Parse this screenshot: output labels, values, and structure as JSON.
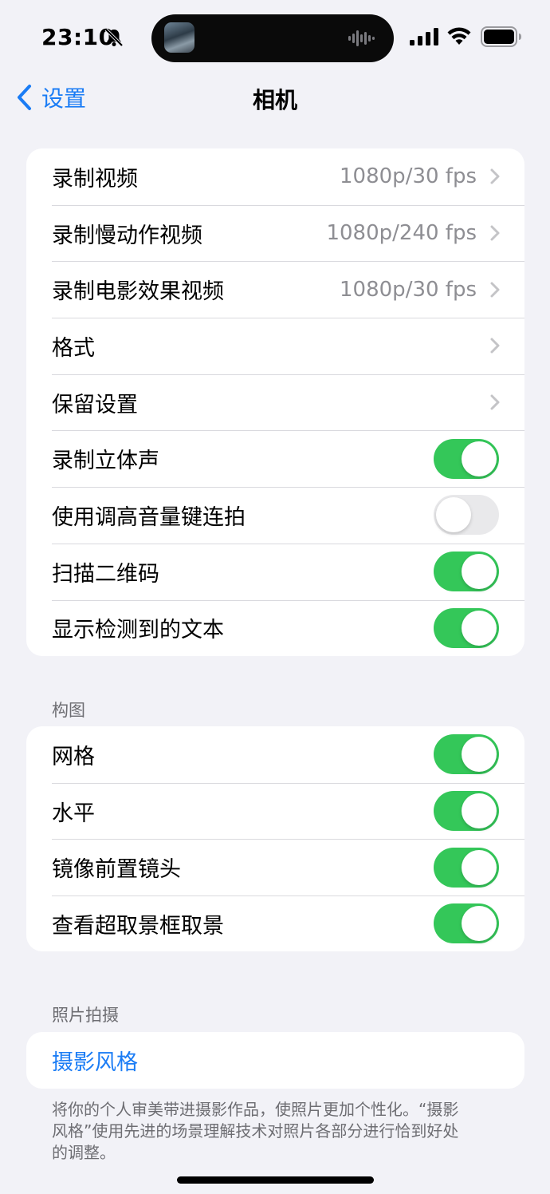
{
  "status_bar": {
    "time": "23:10"
  },
  "nav": {
    "back_label": "设置",
    "title": "相机"
  },
  "group_video": {
    "rows": [
      {
        "label": "录制视频",
        "value": "1080p/30 fps"
      },
      {
        "label": "录制慢动作视频",
        "value": "1080p/240 fps"
      },
      {
        "label": "录制电影效果视频",
        "value": "1080p/30 fps"
      },
      {
        "label": "格式",
        "value": ""
      },
      {
        "label": "保留设置",
        "value": ""
      },
      {
        "label": "录制立体声",
        "on": true
      },
      {
        "label": "使用调高音量键连拍",
        "on": false
      },
      {
        "label": "扫描二维码",
        "on": true
      },
      {
        "label": "显示检测到的文本",
        "on": true
      }
    ]
  },
  "composition": {
    "header": "构图",
    "rows": [
      {
        "label": "网格",
        "on": true
      },
      {
        "label": "水平",
        "on": true
      },
      {
        "label": "镜像前置镜头",
        "on": true
      },
      {
        "label": "查看超取景框取景",
        "on": true
      }
    ]
  },
  "photo_capture": {
    "header": "照片拍摄",
    "link_label": "摄影风格",
    "footer": "将你的个人审美带进摄影作品，使照片更加个性化。“摄影风格”使用先进的场景理解技术对照片各部分进行恰到好处的调整。"
  },
  "colors": {
    "accent": "#1a7cf5",
    "toggle_on": "#34c759",
    "toggle_off": "#e9e9eb",
    "background": "#f2f2f7"
  }
}
